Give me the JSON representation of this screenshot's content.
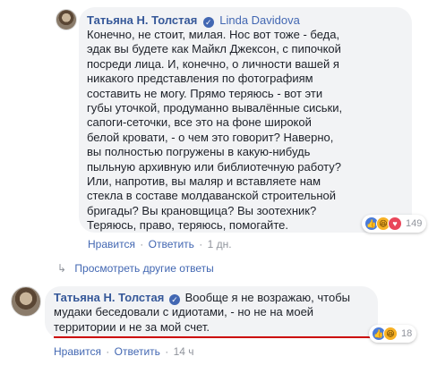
{
  "comment1": {
    "author": "Татьяна Н. Толстая",
    "mention": "Linda Davidova",
    "lines": [
      "Конечно, не стоит, милая. Нос вот тоже - беда,",
      "эдак вы будете как Майкл Джексон, с пипочкой",
      "посреди лица. И, конечно, о личности вашей я",
      "никакого представления по фотографиям",
      "составить не могу. Прямо теряюсь - вот эти",
      "губы уточкой, продуманно вывалённые сиськи,",
      "сапоги-сеточки, все это на фоне широкой",
      "белой кровати, - о чем это говорит? Наверно,",
      "вы полностью погружены в какую-нибудь",
      "пыльную архивную или библиотечную работу?",
      "Или, напротив, вы маляр и вставляете нам",
      "стекла в составе молдаванской строительной",
      "бригады? Вы крановщица? Вы зоотехник?",
      "Теряюсь, право, теряюсь, помогайте."
    ],
    "reaction_count": "149",
    "reaction_icons": [
      "like-icon",
      "haha-icon",
      "love-icon"
    ],
    "actions": {
      "like": "Нравится",
      "reply": "Ответить",
      "time": "1 дн.",
      "dot": "·"
    }
  },
  "replies_link": {
    "label": "Просмотреть другие ответы",
    "icon": "reply-arrow-icon"
  },
  "comment2": {
    "author": "Татьяна Н. Толстая",
    "lines": [
      "Вообще я не возражаю, чтобы",
      "мудаки беседовали с идиотами, - но не на моей",
      "территории и не за мой счет."
    ],
    "reaction_count": "18",
    "reaction_icons": [
      "like-icon",
      "haha-icon"
    ],
    "actions": {
      "like": "Нравится",
      "reply": "Ответить",
      "time": "14 ч",
      "dot": "·"
    }
  },
  "colors": {
    "link": "#4267b2",
    "name": "#365899",
    "bubble": "#f2f3f5",
    "underline": "#cc0000"
  }
}
